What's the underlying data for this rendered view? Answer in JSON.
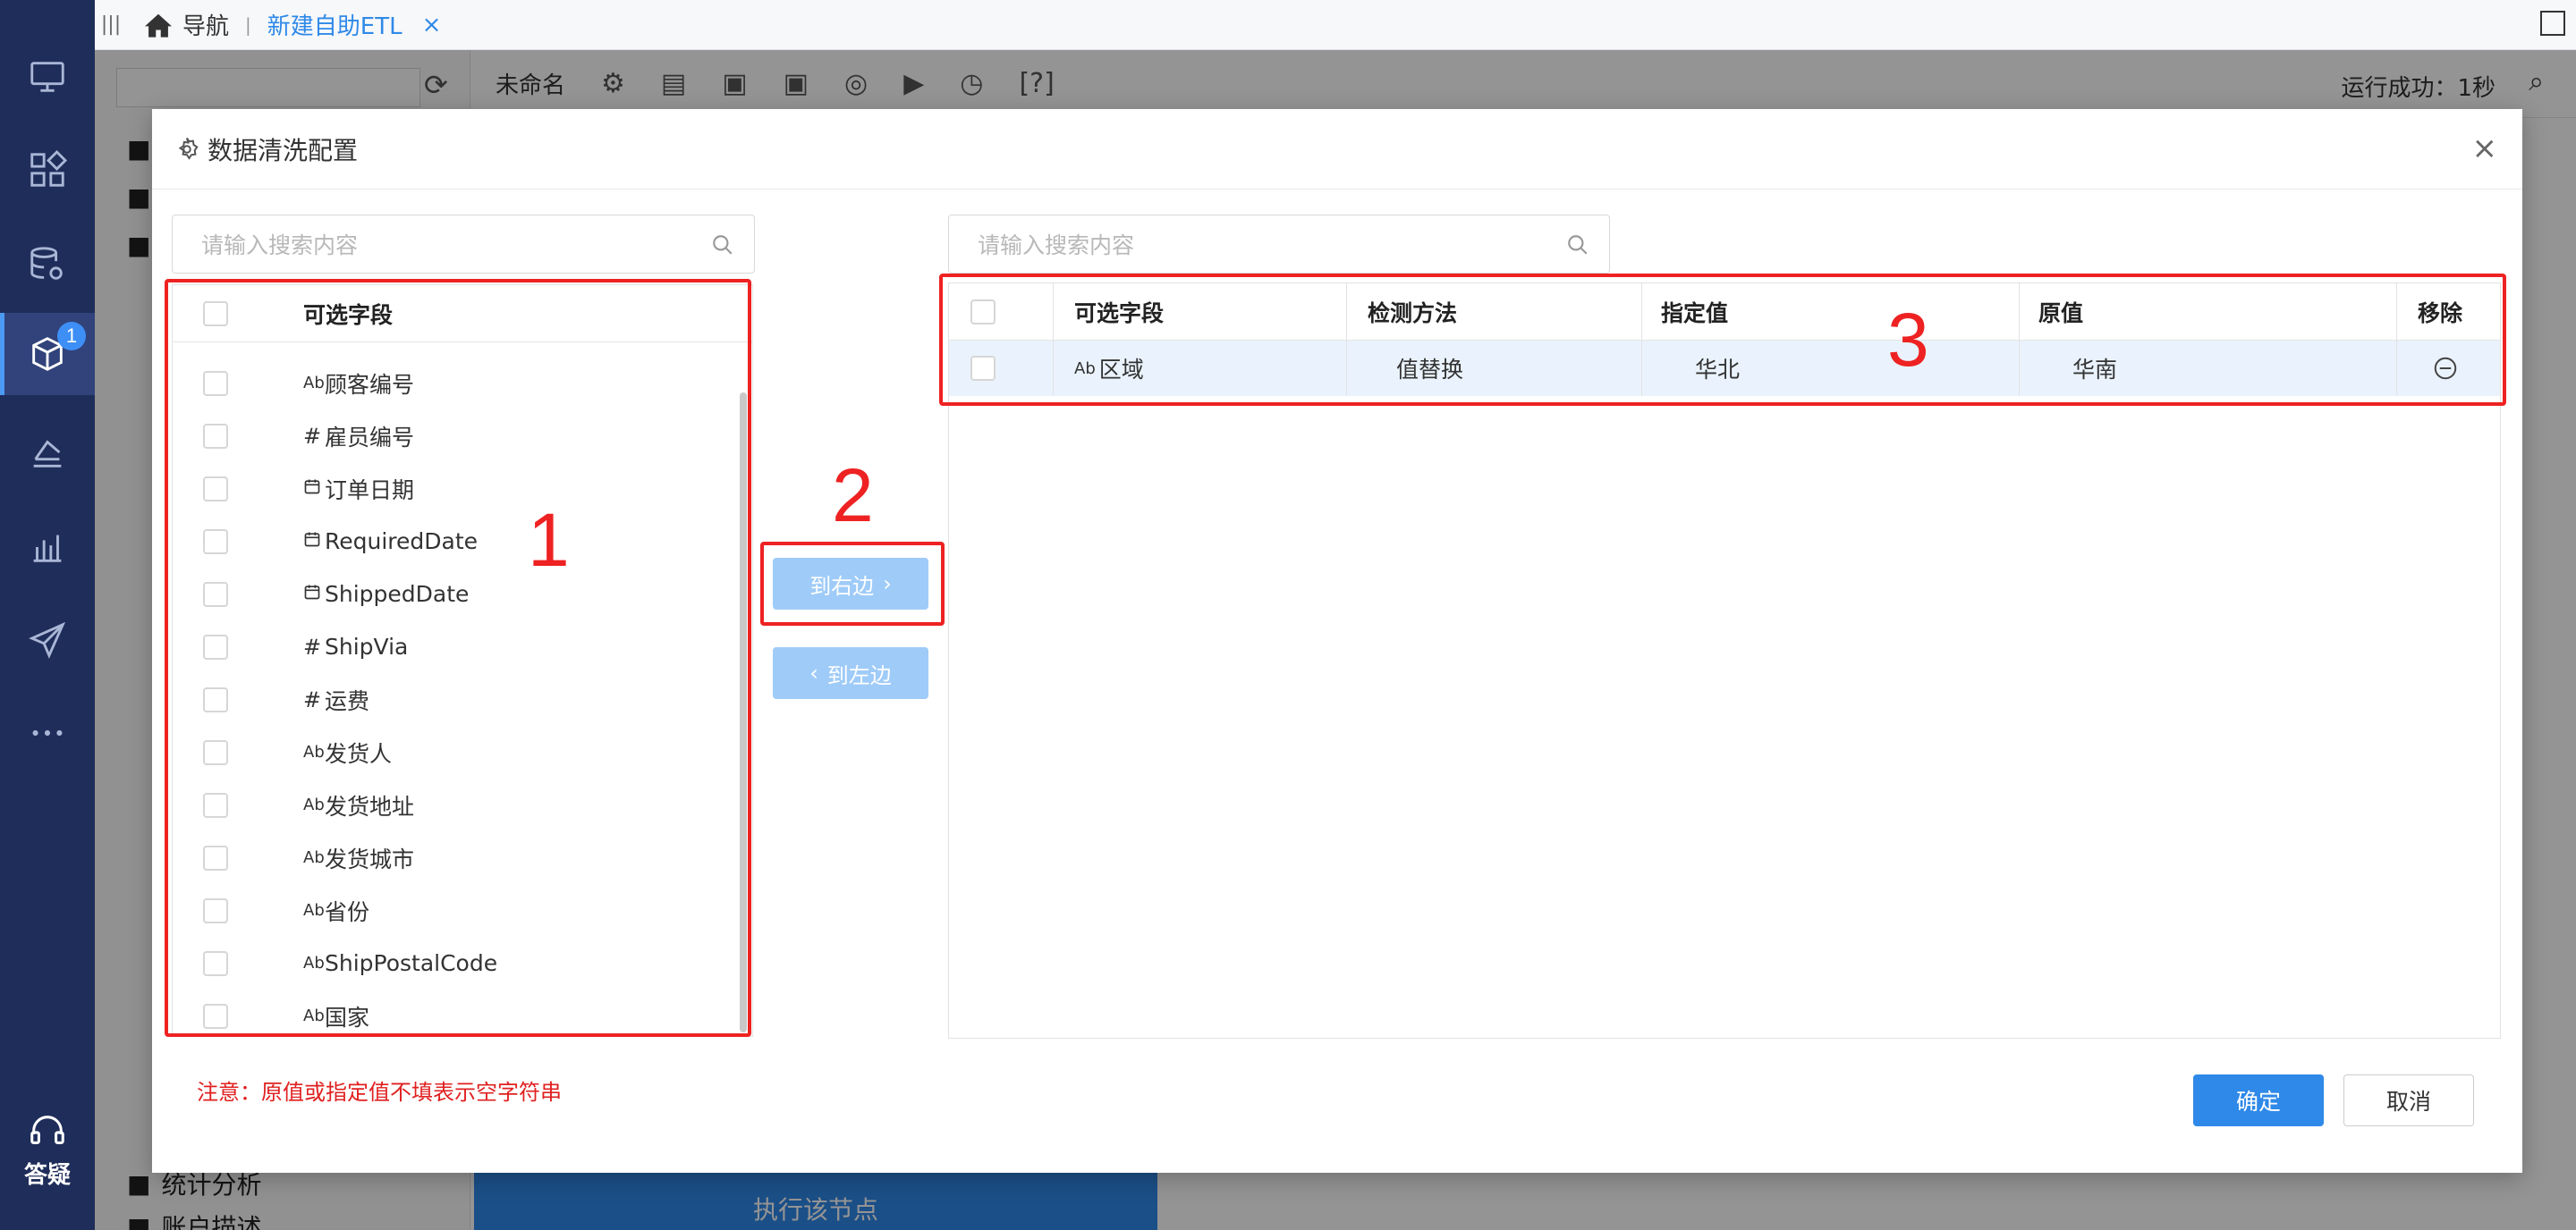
{
  "rail": {
    "badge": "1",
    "help_label": "答疑",
    "icons": [
      "monitor-icon",
      "dashboard-icon",
      "database-gear-icon",
      "cube-icon",
      "dataset-icon",
      "chart-icon",
      "send-icon",
      "more-icon"
    ]
  },
  "tabs": {
    "home_label": "导航",
    "separator": "|",
    "active_label": "新建自助ETL",
    "close_label": "×"
  },
  "workspace": {
    "name": "未命名",
    "status": "运行成功：1秒",
    "bottom_folder1": "统计分析",
    "bottom_folder2": "账户描述",
    "run_label": "执行该节点"
  },
  "dialog": {
    "title": "数据清洗配置",
    "close": "×",
    "left_search_placeholder": "请输入搜索内容",
    "right_search_placeholder": "请输入搜索内容",
    "left_header": "可选字段",
    "left_fields": [
      {
        "type": "Ab",
        "label": "顾客编号"
      },
      {
        "type": "#",
        "label": "雇员编号"
      },
      {
        "type": "date",
        "label": "订单日期"
      },
      {
        "type": "date",
        "label": "RequiredDate"
      },
      {
        "type": "date",
        "label": "ShippedDate"
      },
      {
        "type": "#",
        "label": "ShipVia"
      },
      {
        "type": "#",
        "label": "运费"
      },
      {
        "type": "Ab",
        "label": "发货人"
      },
      {
        "type": "Ab",
        "label": "发货地址"
      },
      {
        "type": "Ab",
        "label": "发货城市"
      },
      {
        "type": "Ab",
        "label": "省份"
      },
      {
        "type": "Ab",
        "label": "ShipPostalCode"
      },
      {
        "type": "Ab",
        "label": "国家"
      }
    ],
    "to_right": "到右边",
    "to_left": "到左边",
    "right_headers": [
      "可选字段",
      "检测方法",
      "指定值",
      "原值",
      "移除"
    ],
    "right_rows": [
      {
        "type": "Ab",
        "field": "区域",
        "method": "值替换",
        "target": "华北",
        "original": "华南"
      }
    ],
    "note": "注意：原值或指定值不填表示空字符串",
    "ok": "确定",
    "cancel": "取消"
  },
  "annotations": [
    "1",
    "2",
    "3"
  ],
  "colors": {
    "rail": "#1f2d5a",
    "accent": "#2f89e8",
    "annotation": "#ee2222"
  }
}
